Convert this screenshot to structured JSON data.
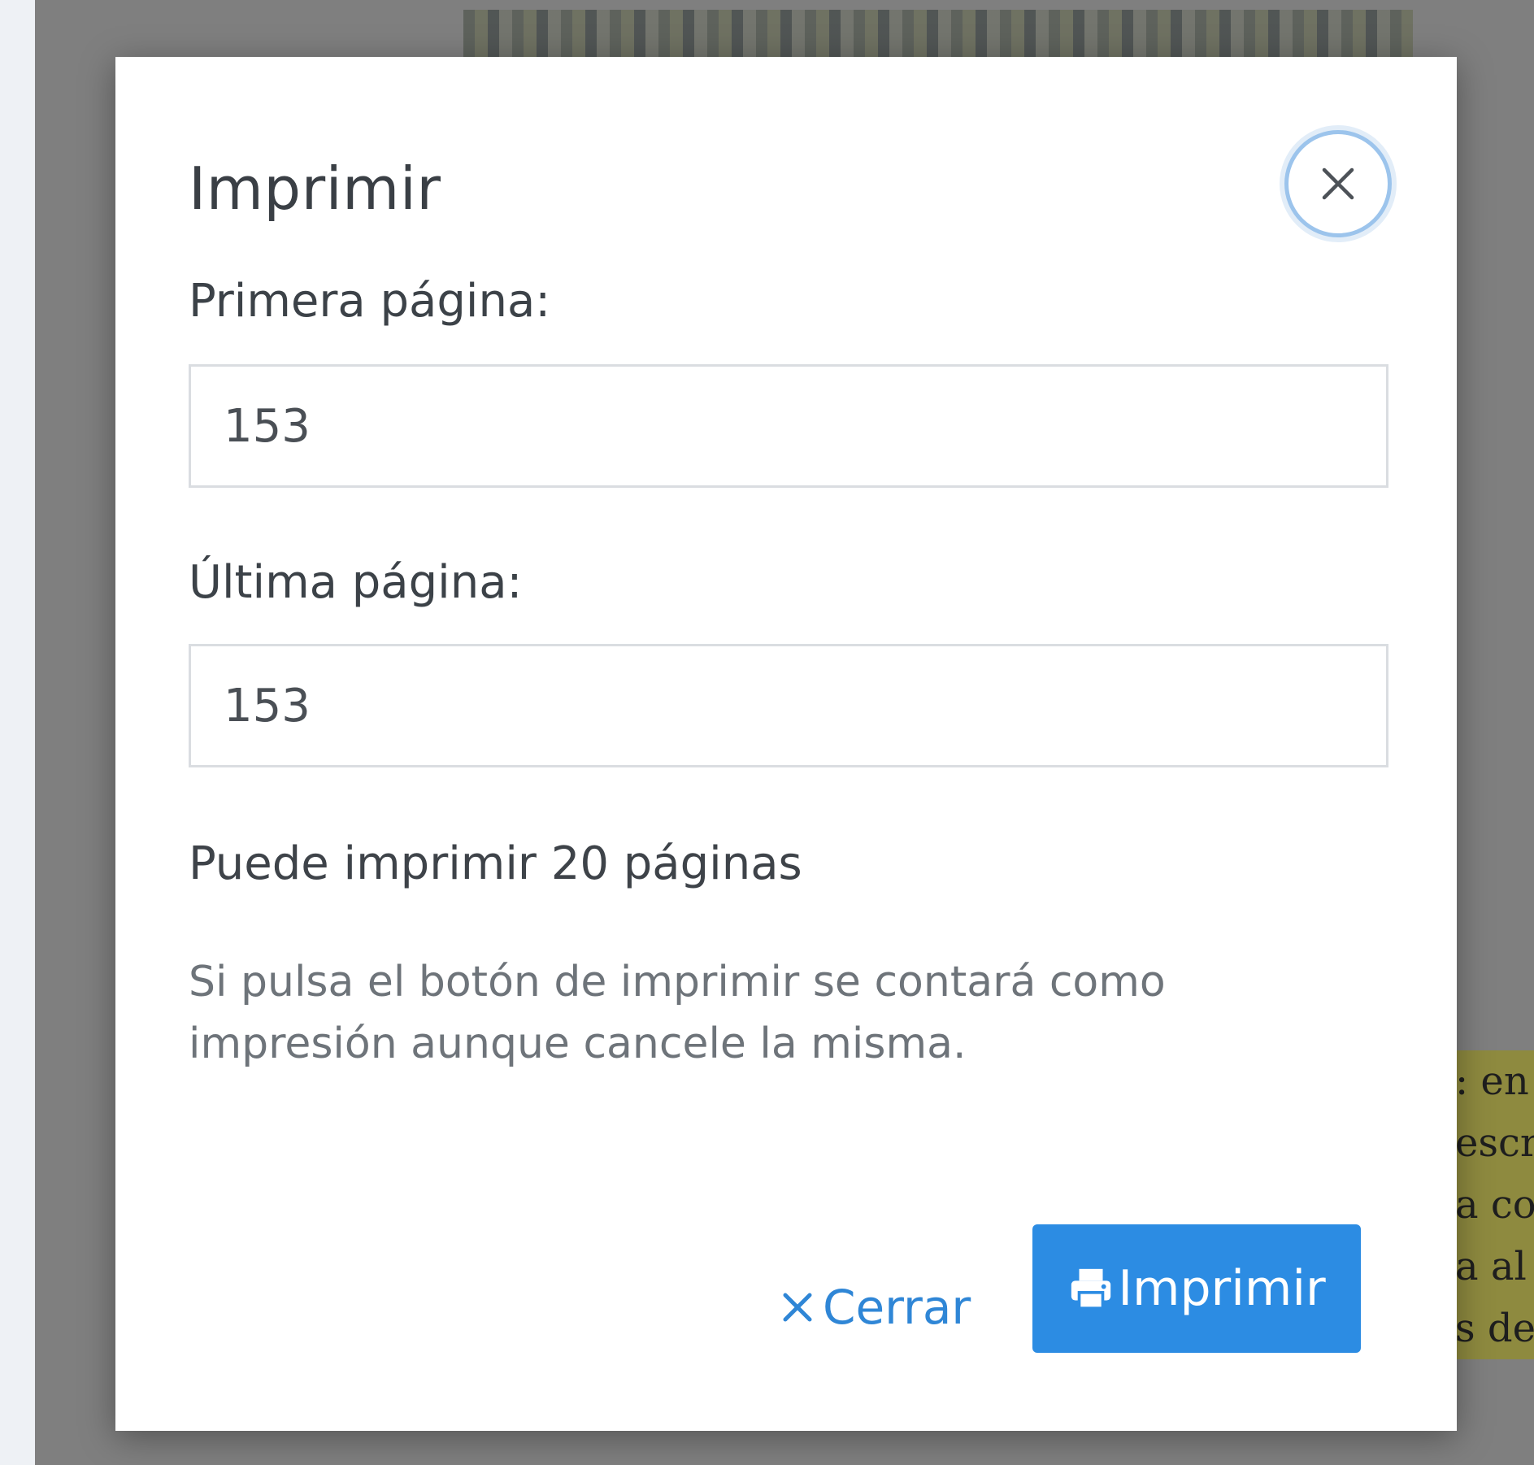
{
  "background": {
    "page_text_lines": [
      ": en",
      "escr",
      "a co",
      "a al",
      "s de"
    ]
  },
  "modal": {
    "title": "Imprimir",
    "close_icon": "close-icon",
    "first_page": {
      "label": "Primera página:",
      "value": "153"
    },
    "last_page": {
      "label": "Última página:",
      "value": "153"
    },
    "print_count_text": "Puede imprimir 20 páginas",
    "notice_text": "Si pulsa el botón de imprimir se contará como impresión aunque cancele la misma.",
    "buttons": {
      "close_icon": "close-x-icon",
      "close_label": "Cerrar",
      "print_icon": "printer-icon",
      "print_label": "Imprimir"
    }
  },
  "colors": {
    "primary": "#2c8ce3",
    "link": "#2f86d6",
    "overlay": "#7f7f7f"
  }
}
